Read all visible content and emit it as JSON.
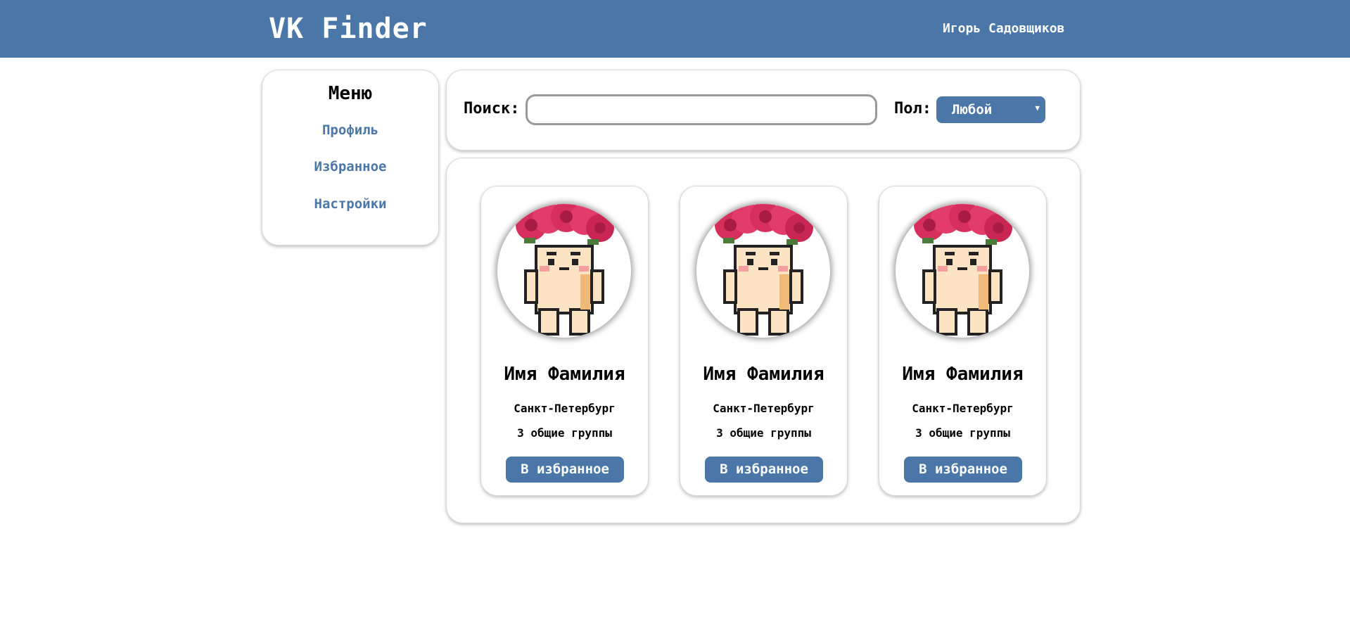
{
  "header": {
    "logo": "VK Finder",
    "user_name": "Игорь Садовщиков"
  },
  "sidebar": {
    "title": "Меню",
    "items": [
      {
        "label": "Профиль"
      },
      {
        "label": "Избранное"
      },
      {
        "label": "Настройки"
      }
    ]
  },
  "search": {
    "label": "Поиск:",
    "value": "",
    "placeholder": "",
    "gender_label": "Пол:",
    "gender_value": "Любой",
    "dropdown_icon": "triangle-down-icon"
  },
  "cards": [
    {
      "name": "Имя Фамилия",
      "city": "Санкт-Петербург",
      "groups": "3 общие группы",
      "button": "В избранное",
      "avatar": "pixel-character-flower-crown"
    },
    {
      "name": "Имя Фамилия",
      "city": "Санкт-Петербург",
      "groups": "3 общие группы",
      "button": "В избранное",
      "avatar": "pixel-character-flower-crown"
    },
    {
      "name": "Имя Фамилия",
      "city": "Санкт-Петербург",
      "groups": "3 общие группы",
      "button": "В избранное",
      "avatar": "pixel-character-flower-crown"
    }
  ],
  "colors": {
    "accent": "#4a76a8",
    "background": "#ffffff",
    "border": "#d9d9d9"
  }
}
